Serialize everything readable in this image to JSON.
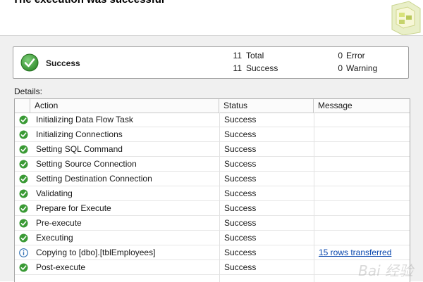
{
  "header": {
    "title": "The execution was successful"
  },
  "summary": {
    "status": "Success",
    "total_count": "11",
    "total_label": "Total",
    "success_count": "11",
    "success_label": "Success",
    "error_count": "0",
    "error_label": "Error",
    "warning_count": "0",
    "warning_label": "Warning"
  },
  "details": {
    "label": "Details:",
    "columns": [
      "Action",
      "Status",
      "Message"
    ],
    "rows": [
      {
        "icon": "success-check-icon",
        "action": "Initializing Data Flow Task",
        "status": "Success",
        "message": ""
      },
      {
        "icon": "success-check-icon",
        "action": "Initializing Connections",
        "status": "Success",
        "message": ""
      },
      {
        "icon": "success-check-icon",
        "action": "Setting SQL Command",
        "status": "Success",
        "message": ""
      },
      {
        "icon": "success-check-icon",
        "action": "Setting Source Connection",
        "status": "Success",
        "message": ""
      },
      {
        "icon": "success-check-icon",
        "action": "Setting Destination Connection",
        "status": "Success",
        "message": ""
      },
      {
        "icon": "success-check-icon",
        "action": "Validating",
        "status": "Success",
        "message": ""
      },
      {
        "icon": "success-check-icon",
        "action": "Prepare for Execute",
        "status": "Success",
        "message": ""
      },
      {
        "icon": "success-check-icon",
        "action": "Pre-execute",
        "status": "Success",
        "message": ""
      },
      {
        "icon": "success-check-icon",
        "action": "Executing",
        "status": "Success",
        "message": ""
      },
      {
        "icon": "info-icon",
        "action": "Copying to [dbo].[tblEmployees]",
        "status": "Success",
        "message": "15 rows transferred"
      },
      {
        "icon": "success-check-icon",
        "action": "Post-execute",
        "status": "Success",
        "message": ""
      }
    ]
  },
  "colors": {
    "success_green": "#3a9a35",
    "info_blue": "#2f6fb3",
    "link": "#0645ad"
  }
}
